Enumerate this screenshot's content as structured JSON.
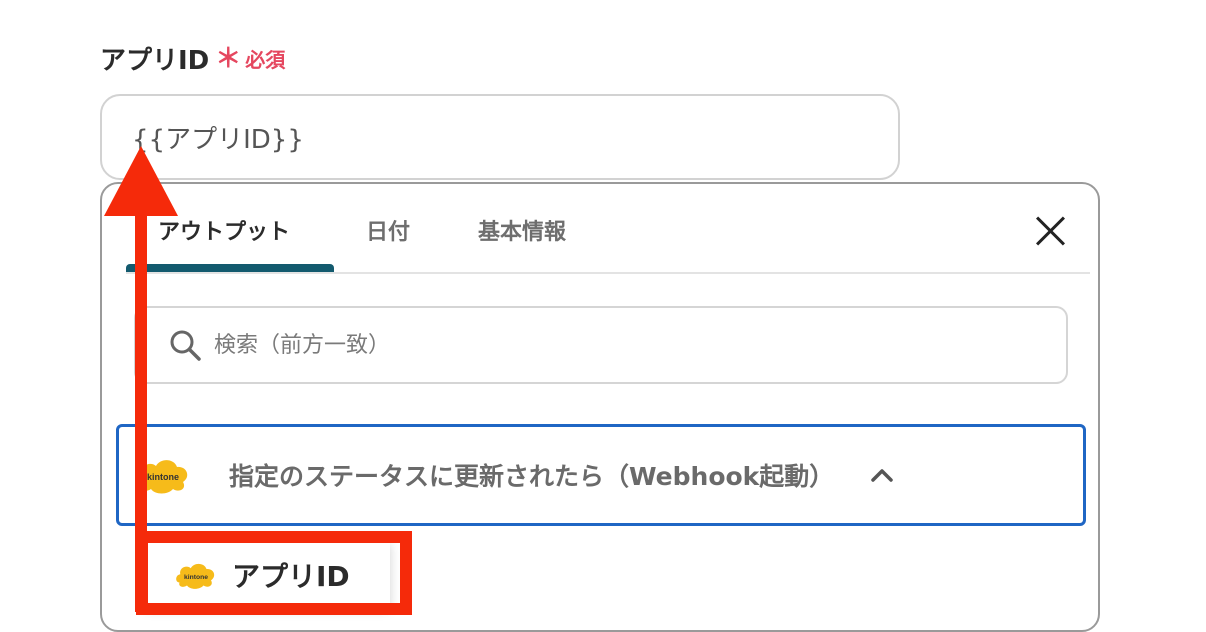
{
  "field": {
    "label": "アプリID",
    "required_mark": "＊",
    "required_text": "必須",
    "value": "{{アプリID}}"
  },
  "panel": {
    "tabs": [
      {
        "label": "アウトプット",
        "active": true
      },
      {
        "label": "日付",
        "active": false
      },
      {
        "label": "基本情報",
        "active": false
      }
    ],
    "search": {
      "placeholder": "検索（前方一致）"
    },
    "section": {
      "title": "指定のステータスに更新されたら（Webhook起動）"
    },
    "items": [
      {
        "label": "アプリID"
      }
    ],
    "logo_text": "kintone"
  },
  "colors": {
    "required": "#e5475f",
    "tab_indicator": "#135a6e",
    "section_border": "#1f66c4",
    "annotation": "#f52a0a",
    "kintone_cloud": "#f6bb1a"
  },
  "icons": [
    "search-icon",
    "close-icon",
    "chevron-up-icon",
    "kintone-logo"
  ]
}
